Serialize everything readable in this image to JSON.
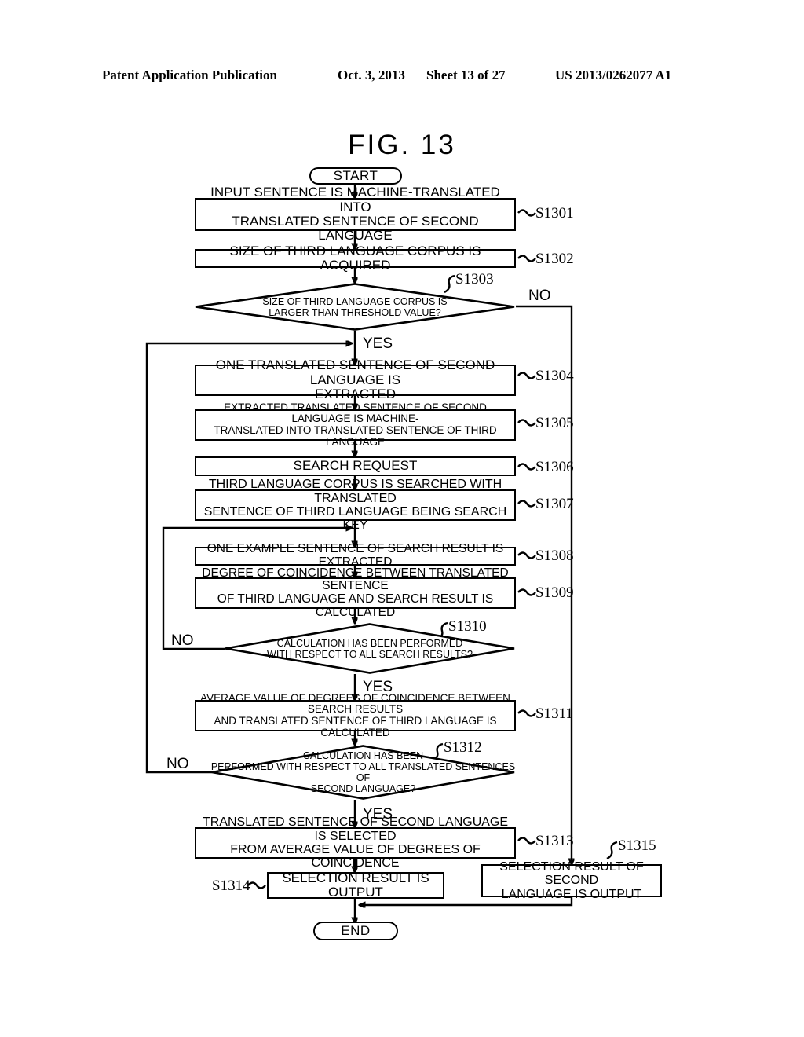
{
  "header": {
    "publication": "Patent Application Publication",
    "date": "Oct. 3, 2013",
    "sheet": "Sheet 13 of 27",
    "patent_number": "US 2013/0262077 A1"
  },
  "figure": {
    "title": "FIG. 13",
    "type": "flowchart"
  },
  "terminals": {
    "start": "START",
    "end": "END"
  },
  "branch_labels": {
    "s1303_no": "NO",
    "s1303_yes": "YES",
    "s1310_no": "NO",
    "s1310_yes": "YES",
    "s1312_no": "NO",
    "s1312_yes": "YES"
  },
  "nodes": [
    {
      "id": "S1301",
      "kind": "process",
      "ref": "S1301",
      "lines": [
        "INPUT SENTENCE IS MACHINE-TRANSLATED INTO",
        "TRANSLATED SENTENCE OF SECOND LANGUAGE"
      ]
    },
    {
      "id": "S1302",
      "kind": "process",
      "ref": "S1302",
      "lines": [
        "SIZE OF THIRD LANGUAGE CORPUS IS ACQUIRED"
      ]
    },
    {
      "id": "S1303",
      "kind": "decision",
      "ref": "S1303",
      "lines": [
        "SIZE OF THIRD LANGUAGE CORPUS IS",
        "LARGER THAN THRESHOLD VALUE?"
      ]
    },
    {
      "id": "S1304",
      "kind": "process",
      "ref": "S1304",
      "lines": [
        "ONE TRANSLATED SENTENCE OF SECOND LANGUAGE IS",
        "EXTRACTED"
      ]
    },
    {
      "id": "S1305",
      "kind": "process",
      "ref": "S1305",
      "lines": [
        "EXTRACTED TRANSLATED SENTENCE OF SECOND LANGUAGE IS MACHINE-",
        "TRANSLATED INTO TRANSLATED SENTENCE OF THIRD LANGUAGE"
      ]
    },
    {
      "id": "S1306",
      "kind": "process",
      "ref": "S1306",
      "lines": [
        "SEARCH REQUEST"
      ]
    },
    {
      "id": "S1307",
      "kind": "process",
      "ref": "S1307",
      "lines": [
        "THIRD LANGUAGE CORPUS IS SEARCHED WITH TRANSLATED",
        "SENTENCE OF THIRD LANGUAGE BEING SEARCH KEY"
      ]
    },
    {
      "id": "S1308",
      "kind": "process",
      "ref": "S1308",
      "lines": [
        "ONE EXAMPLE SENTENCE OF SEARCH RESULT IS EXTRACTED"
      ]
    },
    {
      "id": "S1309",
      "kind": "process",
      "ref": "S1309",
      "lines": [
        "DEGREE OF COINCIDENCE BETWEEN TRANSLATED SENTENCE",
        "OF THIRD LANGUAGE AND SEARCH RESULT IS CALCULATED"
      ]
    },
    {
      "id": "S1310",
      "kind": "decision",
      "ref": "S1310",
      "lines": [
        "CALCULATION HAS BEEN PERFORMED",
        "WITH RESPECT TO ALL SEARCH RESULTS?"
      ]
    },
    {
      "id": "S1311",
      "kind": "process",
      "ref": "S1311",
      "lines": [
        "AVERAGE VALUE OF DEGREES OF COINCIDENCE BETWEEN SEARCH RESULTS",
        "AND TRANSLATED SENTENCE OF THIRD LANGUAGE IS CALCULATED"
      ]
    },
    {
      "id": "S1312",
      "kind": "decision",
      "ref": "S1312",
      "lines": [
        "CALCULATION HAS BEEN",
        "PERFORMED WITH RESPECT TO ALL TRANSLATED SENTENCES OF",
        "SECOND LANGUAGE?"
      ]
    },
    {
      "id": "S1313",
      "kind": "process",
      "ref": "S1313",
      "lines": [
        "TRANSLATED SENTENCE OF SECOND LANGUAGE IS SELECTED",
        "FROM AVERAGE VALUE OF DEGREES OF COINCIDENCE"
      ]
    },
    {
      "id": "S1314",
      "kind": "process",
      "ref": "S1314",
      "lines": [
        "SELECTION RESULT IS OUTPUT"
      ]
    },
    {
      "id": "S1315",
      "kind": "process",
      "ref": "S1315",
      "lines": [
        "SELECTION RESULT OF SECOND",
        "LANGUAGE IS OUTPUT"
      ]
    }
  ]
}
